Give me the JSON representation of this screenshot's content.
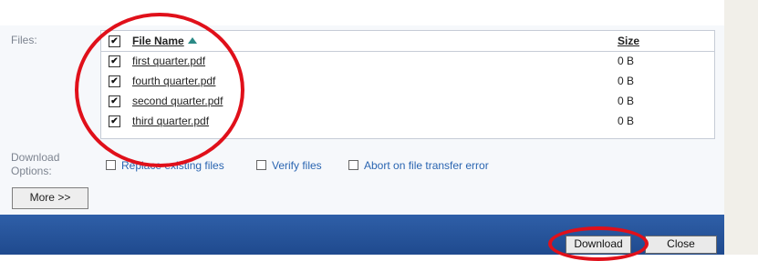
{
  "files_label": "Files:",
  "table": {
    "header": {
      "file_name": "File Name",
      "size": "Size",
      "checked": "✔"
    },
    "rows": [
      {
        "name": "first quarter.pdf",
        "size": "0 B",
        "checked": "✔"
      },
      {
        "name": "fourth quarter.pdf",
        "size": "0 B",
        "checked": "✔"
      },
      {
        "name": "second quarter.pdf",
        "size": "0 B",
        "checked": "✔"
      },
      {
        "name": "third quarter.pdf",
        "size": "0 B",
        "checked": "✔"
      }
    ]
  },
  "download_options": {
    "label": "Download Options:",
    "options": [
      "Replace existing files",
      "Verify files",
      "Abort on file transfer error"
    ]
  },
  "more_button": "More >>",
  "footer": {
    "download": "Download",
    "close": "Close"
  },
  "colors": {
    "footer": "#2f5fa8",
    "annotation": "#e0101a",
    "option_link": "#2a65b1",
    "sort_arrow": "#2b8a86"
  },
  "icons": {
    "sort": "sort-ascending-icon",
    "checkbox": "checkbox-checked-icon"
  }
}
